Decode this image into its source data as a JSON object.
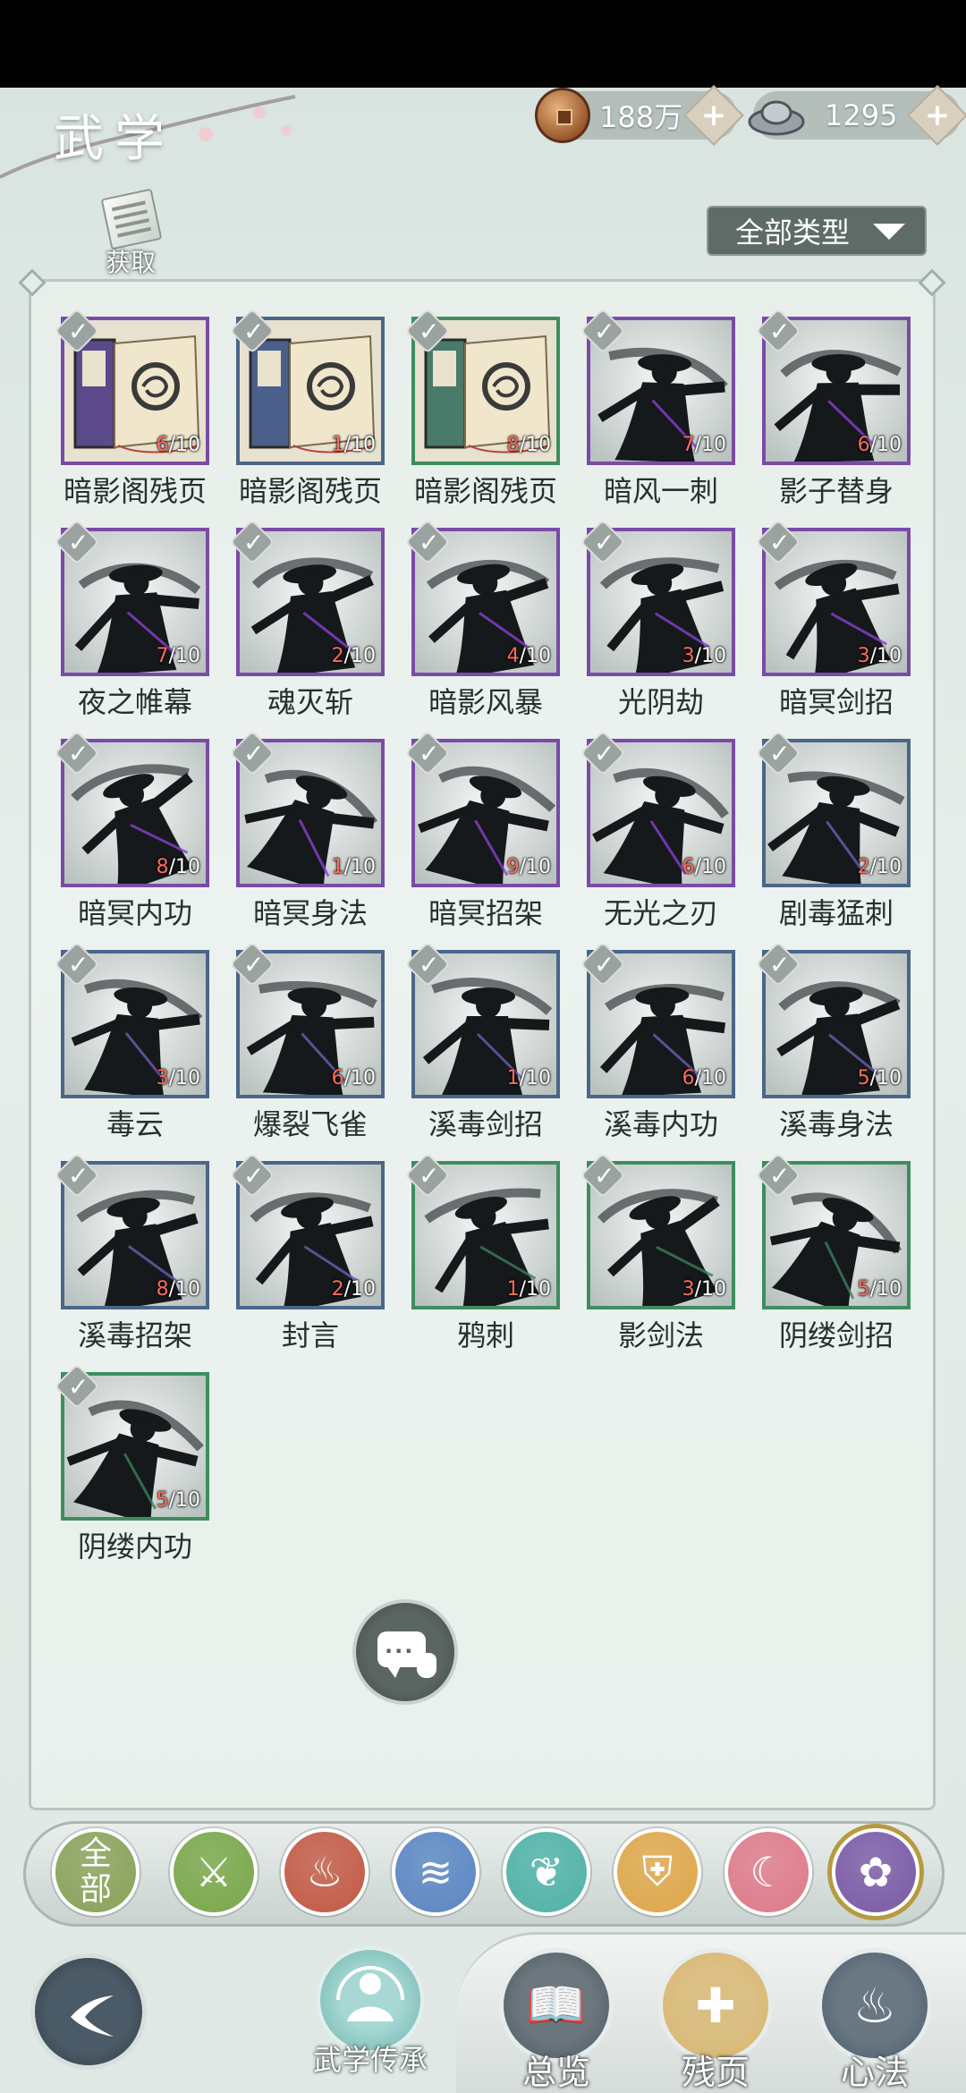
{
  "header": {
    "title": "武学",
    "coins": "188万",
    "silver": "1295",
    "acquire_label": "获取",
    "type_filter": "全部类型"
  },
  "items": [
    {
      "name": "暗影阁残页",
      "own": "6",
      "total": "/10",
      "frame": "purple",
      "art": "book-purple"
    },
    {
      "name": "暗影阁残页",
      "own": "1",
      "total": "/10",
      "frame": "blue",
      "art": "book-blue"
    },
    {
      "name": "暗影阁残页",
      "own": "8",
      "total": "/10",
      "frame": "green",
      "art": "book-green"
    },
    {
      "name": "暗风一刺",
      "own": "7",
      "total": "/10",
      "frame": "purple",
      "art": "shadow"
    },
    {
      "name": "影子替身",
      "own": "6",
      "total": "/10",
      "frame": "purple",
      "art": "shadow"
    },
    {
      "name": "夜之帷幕",
      "own": "7",
      "total": "/10",
      "frame": "purple",
      "art": "shadow"
    },
    {
      "name": "魂灭斩",
      "own": "2",
      "total": "/10",
      "frame": "purple",
      "art": "shadow"
    },
    {
      "name": "暗影风暴",
      "own": "4",
      "total": "/10",
      "frame": "purple",
      "art": "shadow"
    },
    {
      "name": "光阴劫",
      "own": "3",
      "total": "/10",
      "frame": "purple",
      "art": "shadow"
    },
    {
      "name": "暗冥剑招",
      "own": "3",
      "total": "/10",
      "frame": "purple",
      "art": "shadow"
    },
    {
      "name": "暗冥内功",
      "own": "8",
      "total": "/10",
      "frame": "purple",
      "art": "shadow"
    },
    {
      "name": "暗冥身法",
      "own": "1",
      "total": "/10",
      "frame": "purple",
      "art": "shadow"
    },
    {
      "name": "暗冥招架",
      "own": "9",
      "total": "/10",
      "frame": "purple",
      "art": "shadow"
    },
    {
      "name": "无光之刃",
      "own": "6",
      "total": "/10",
      "frame": "purple",
      "art": "shadow"
    },
    {
      "name": "剧毒猛刺",
      "own": "2",
      "total": "/10",
      "frame": "blue",
      "art": "shadow"
    },
    {
      "name": "毒云",
      "own": "3",
      "total": "/10",
      "frame": "blue",
      "art": "shadow"
    },
    {
      "name": "爆裂飞雀",
      "own": "6",
      "total": "/10",
      "frame": "blue",
      "art": "shadow"
    },
    {
      "name": "溪毒剑招",
      "own": "1",
      "total": "/10",
      "frame": "blue",
      "art": "shadow"
    },
    {
      "name": "溪毒内功",
      "own": "6",
      "total": "/10",
      "frame": "blue",
      "art": "shadow"
    },
    {
      "name": "溪毒身法",
      "own": "5",
      "total": "/10",
      "frame": "blue",
      "art": "shadow"
    },
    {
      "name": "溪毒招架",
      "own": "8",
      "total": "/10",
      "frame": "blue",
      "art": "shadow"
    },
    {
      "name": "封言",
      "own": "2",
      "total": "/10",
      "frame": "blue",
      "art": "shadow"
    },
    {
      "name": "鸦刺",
      "own": "1",
      "total": "/10",
      "frame": "green",
      "art": "shadow"
    },
    {
      "name": "影剑法",
      "own": "3",
      "total": "/10",
      "frame": "green",
      "art": "shadow"
    },
    {
      "name": "阴缕剑招",
      "own": "5",
      "total": "/10",
      "frame": "green",
      "art": "shadow"
    },
    {
      "name": "阴缕内功",
      "own": "5",
      "total": "/10",
      "frame": "green",
      "art": "shadow"
    }
  ],
  "categories": [
    {
      "label": "全部",
      "color": "#8aa35a",
      "icon": "all-icon"
    },
    {
      "label": "",
      "color": "#7aa84a",
      "icon": "sword-icon"
    },
    {
      "label": "",
      "color": "#c45a45",
      "icon": "flame-icon"
    },
    {
      "label": "",
      "color": "#5b86c4",
      "icon": "wave-icon"
    },
    {
      "label": "",
      "color": "#4fb3a8",
      "icon": "butterfly-icon"
    },
    {
      "label": "",
      "color": "#e0a84a",
      "icon": "shield-icon"
    },
    {
      "label": "",
      "color": "#e07a8a",
      "icon": "moon-icon"
    },
    {
      "label": "",
      "color": "#7b5aa8",
      "icon": "rose-icon"
    }
  ],
  "bottom": {
    "legacy_label": "武学传承",
    "tabs": [
      {
        "label": "总览",
        "color": "#4d5a63",
        "icon": "book-icon"
      },
      {
        "label": "残页",
        "color": "#d8b46a",
        "icon": "puzzle-icon"
      },
      {
        "label": "心法",
        "color": "#4a5b6a",
        "icon": "flame-heart-icon"
      }
    ]
  }
}
